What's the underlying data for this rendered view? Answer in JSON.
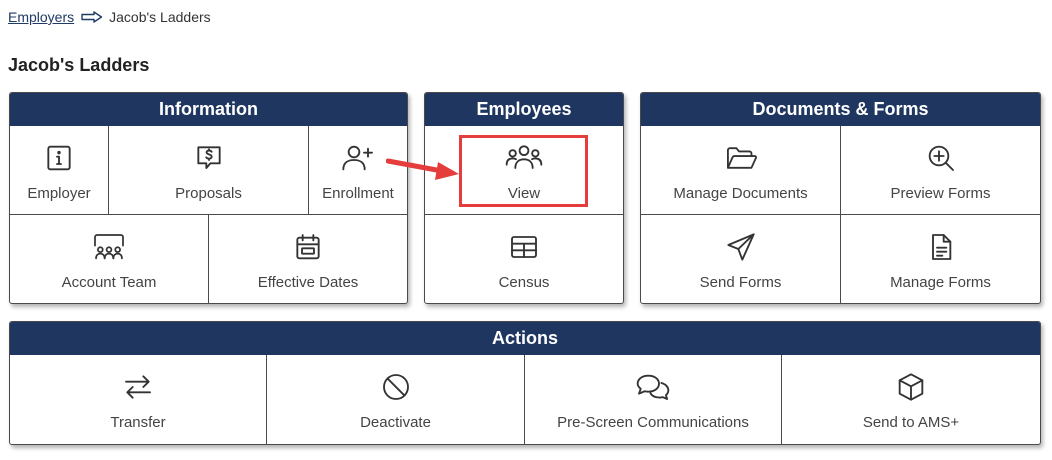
{
  "breadcrumb": {
    "root": "Employers",
    "current": "Jacob's Ladders"
  },
  "page_title": "Jacob's Ladders",
  "information": {
    "title": "Information",
    "employer": "Employer",
    "proposals": "Proposals",
    "enrollment": "Enrollment",
    "account_team": "Account Team",
    "effective_dates": "Effective Dates"
  },
  "employees": {
    "title": "Employees",
    "view": "View",
    "census": "Census"
  },
  "documents": {
    "title": "Documents & Forms",
    "manage_documents": "Manage Documents",
    "preview_forms": "Preview Forms",
    "send_forms": "Send Forms",
    "manage_forms": "Manage Forms"
  },
  "actions": {
    "title": "Actions",
    "transfer": "Transfer",
    "deactivate": "Deactivate",
    "pre_screen": "Pre-Screen Communications",
    "send_to_ams": "Send to AMS+"
  },
  "colors": {
    "header_bg": "#1f3760",
    "header_text": "#ffffff",
    "highlight": "#e53c3c",
    "link": "#1f3a64",
    "border": "#4a4a4a"
  },
  "icons": {
    "breadcrumb_separator": "arrow-right-outline-icon",
    "employer": "info-icon",
    "proposals": "dollar-chat-icon",
    "enrollment": "user-plus-icon",
    "account_team": "team-icon",
    "effective_dates": "calendar-icon",
    "view": "users-icon",
    "census": "table-icon",
    "manage_documents": "folder-open-icon",
    "preview_forms": "zoom-in-icon",
    "send_forms": "paper-plane-icon",
    "manage_forms": "document-icon",
    "transfer": "transfer-icon",
    "deactivate": "ban-icon",
    "pre_screen": "chat-bubbles-icon",
    "send_to_ams": "box-icon"
  }
}
